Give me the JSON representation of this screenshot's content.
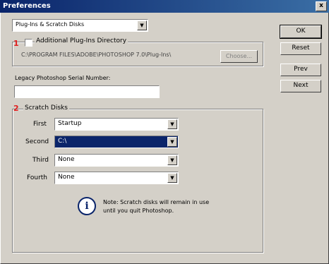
{
  "window": {
    "title": "Preferences",
    "close_label": "x"
  },
  "section_dropdown": {
    "value": "Plug-Ins & Scratch Disks"
  },
  "plugins_group": {
    "marker": "1",
    "checkbox_label": "Additional Plug-Ins Directory",
    "path": "C:\\PROGRAM FILES\\ADOBE\\PHOTOSHOP 7.0\\Plug-Ins\\",
    "choose_label": "Choose..."
  },
  "serial": {
    "label": "Legacy Photoshop Serial Number:",
    "value": ""
  },
  "scratch_group": {
    "marker": "2",
    "legend": "Scratch Disks",
    "rows": [
      {
        "label": "First",
        "value": "Startup"
      },
      {
        "label": "Second",
        "value": "C:\\"
      },
      {
        "label": "Third",
        "value": "None"
      },
      {
        "label": "Fourth",
        "value": "None"
      }
    ],
    "note": "Note: Scratch disks will remain in use until you quit Photoshop."
  },
  "buttons": {
    "ok": "OK",
    "reset": "Reset",
    "prev": "Prev",
    "next": "Next"
  },
  "colors": {
    "title_bar": "#0a246a",
    "marker": "#e02020",
    "selection": "#0a246a"
  }
}
